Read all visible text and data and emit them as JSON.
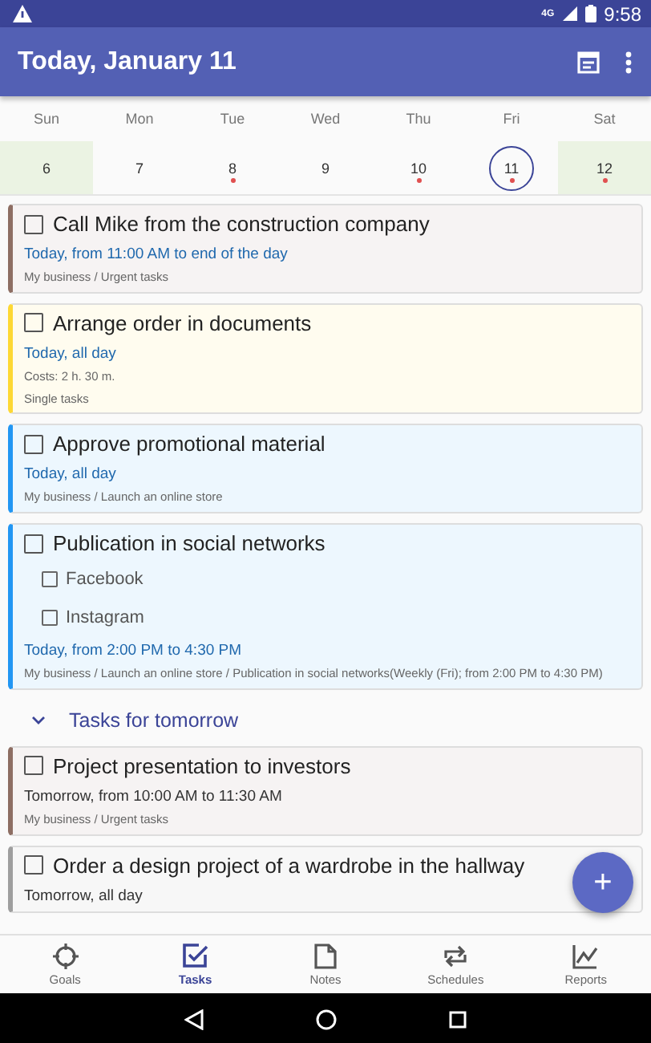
{
  "status_bar": {
    "time": "9:58",
    "network": "4G"
  },
  "app_bar": {
    "title": "Today, January 11"
  },
  "calendar": [
    {
      "day": "Sun",
      "date": "6",
      "weekend": true,
      "has_tasks": false,
      "selected": false
    },
    {
      "day": "Mon",
      "date": "7",
      "weekend": false,
      "has_tasks": false,
      "selected": false
    },
    {
      "day": "Tue",
      "date": "8",
      "weekend": false,
      "has_tasks": true,
      "selected": false
    },
    {
      "day": "Wed",
      "date": "9",
      "weekend": false,
      "has_tasks": false,
      "selected": false
    },
    {
      "day": "Thu",
      "date": "10",
      "weekend": false,
      "has_tasks": true,
      "selected": false
    },
    {
      "day": "Fri",
      "date": "11",
      "weekend": false,
      "has_tasks": true,
      "selected": true
    },
    {
      "day": "Sat",
      "date": "12",
      "weekend": true,
      "has_tasks": true,
      "selected": false
    }
  ],
  "sections": [
    {
      "kind": "today",
      "tasks": [
        {
          "title": "Call Mike from the construction company",
          "checked": false,
          "color": "#8d6e63",
          "when": "Today, from 11:00 AM to end of the day",
          "path": "My business / Urgent tasks"
        },
        {
          "title": "Arrange order in documents",
          "checked": false,
          "color": "#fdd835",
          "when": "Today, all day",
          "costs": "Costs: 2 h. 30 m.",
          "path": "Single tasks"
        },
        {
          "title": "Approve promotional material",
          "checked": false,
          "color": "#2196f3",
          "when": "Today, all day",
          "path": "My business / Launch an online store"
        },
        {
          "title": "Publication in social networks",
          "checked": false,
          "color": "#2196f3",
          "subtasks": [
            {
              "title": "Facebook",
              "checked": false
            },
            {
              "title": "Instagram",
              "checked": false
            }
          ],
          "when": "Today, from 2:00 PM to 4:30 PM",
          "path": "My business / Launch an online store / Publication in social networks(Weekly (Fri); from 2:00 PM to 4:30 PM)"
        }
      ]
    },
    {
      "kind": "tomorrow",
      "header": "Tasks for tomorrow",
      "expanded": true,
      "tasks": [
        {
          "title": "Project presentation to investors",
          "checked": false,
          "color": "#8d6e63",
          "when": "Tomorrow, from 10:00 AM to 11:30 AM",
          "path": "My business / Urgent tasks"
        },
        {
          "title": "Order a design project of a wardrobe in the hallway",
          "checked": false,
          "color": "#9e9e9e",
          "when": "Tomorrow, all day"
        }
      ]
    }
  ],
  "fab": {
    "label": "+"
  },
  "bottom_nav": [
    {
      "label": "Goals",
      "selected": false,
      "kind": "goals"
    },
    {
      "label": "Tasks",
      "selected": true,
      "kind": "tasks"
    },
    {
      "label": "Notes",
      "selected": false,
      "kind": "notes"
    },
    {
      "label": "Schedules",
      "selected": false,
      "kind": "schedules"
    },
    {
      "label": "Reports",
      "selected": false,
      "kind": "reports"
    }
  ]
}
